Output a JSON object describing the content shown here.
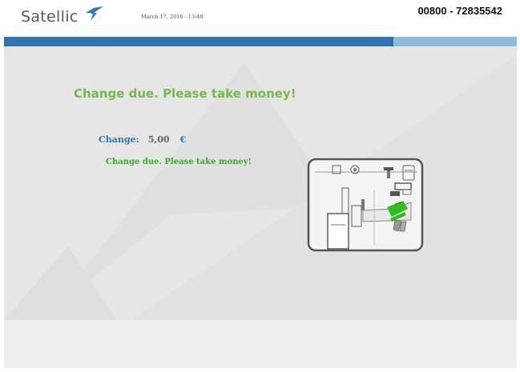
{
  "header": {
    "logo_text": "Satellic",
    "datetime": "March 17, 2016 - 13:48",
    "phone": "00800 - 72835542"
  },
  "colors": {
    "brand_blue": "#2e74b3",
    "light_blue": "#8fbad9",
    "message_green": "#78b84a",
    "highlight_green": "#33aa22"
  },
  "main": {
    "message": "Change due. Please take money!",
    "change_label": "Change:",
    "change_value": "5,00",
    "currency": "€",
    "sub_message": "Change due. Please take money!"
  },
  "illustration": {
    "icon": "terminal-change-tray-illustration"
  }
}
